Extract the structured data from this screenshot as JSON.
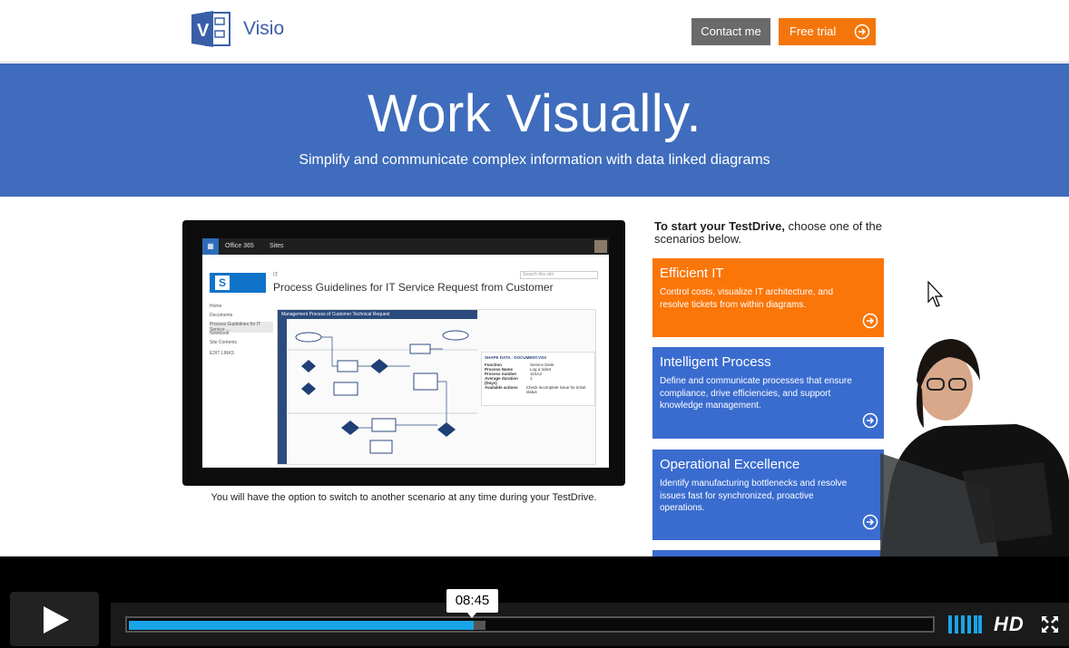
{
  "header": {
    "brand": "Visio",
    "contact_label": "Contact me",
    "trial_label": "Free trial"
  },
  "hero": {
    "title": "Work Visually.",
    "subtitle": "Simplify and communicate complex information with data linked diagrams"
  },
  "tablet": {
    "office_label": "Office 365",
    "sites_label": "Sites",
    "crumb": "IT",
    "page_title": "Process Guidelines for IT Service Request from Customer",
    "search_placeholder": "Search this site",
    "nav": [
      "Home",
      "Documents",
      "Process Guidelines for IT Service ...",
      "Notebook",
      "Site Contents",
      "EDIT LINKS"
    ],
    "diagram_title": "Management Process of Customer Technical Request",
    "panel_title": "SHAPE DATA - DOCUMENT.VSX",
    "panel_rows": [
      [
        "Function",
        "Service Desk"
      ],
      [
        "Process Name",
        "Log a ticket"
      ],
      [
        "Process number",
        "11SA2"
      ],
      [
        "Average duration (Days)",
        "1"
      ],
      [
        "Available actions",
        "Check incomplete issue for ticket status"
      ]
    ],
    "caption": "You will have the option to switch to another scenario at any time during your TestDrive."
  },
  "intro": {
    "bold": "To start your TestDrive,",
    "rest": " choose one of the scenarios below."
  },
  "cards": [
    {
      "title": "Efficient IT",
      "desc": "Control costs, visualize IT architecture, and resolve tickets from within diagrams.",
      "color": "#fa7608"
    },
    {
      "title": "Intelligent Process",
      "desc": "Define and communicate processes that ensure compliance, drive efficiencies, and support knowledge management.",
      "color": "#3a6ccf"
    },
    {
      "title": "Operational Excellence",
      "desc": "Identify manufacturing bottlenecks and resolve issues fast for synchronized, proactive operations.",
      "color": "#3a6ccf"
    }
  ],
  "player": {
    "time_tooltip": "08:45",
    "progress_fraction": 0.43,
    "buffer_fraction": 0.445,
    "hd_label": "HD",
    "accent": "#19a4e8"
  }
}
